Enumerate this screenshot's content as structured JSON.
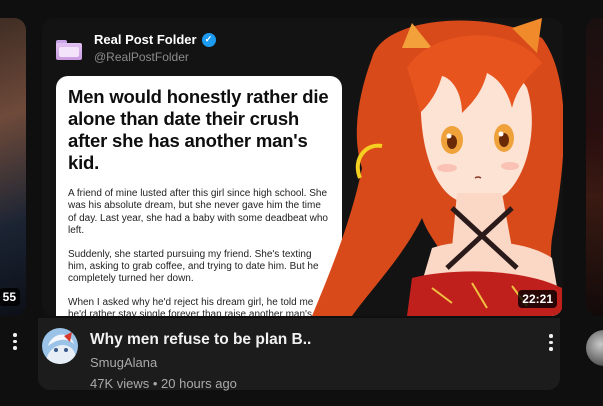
{
  "left_card": {
    "duration": "55"
  },
  "main_card": {
    "thumbnail": {
      "account_name": "Real Post Folder",
      "account_handle": "@RealPostFolder",
      "post_headline": "Men would honestly rather die alone than date their crush after she has another man's kid.",
      "post_paragraphs": [
        "A friend of mine lusted after this girl since high school. She was his absolute dream, but she never gave him the time of day. Last year, she had a baby with some deadbeat who left.",
        "Suddenly, she started pursuing my friend. She's texting him, asking to grab coffee, and trying to date him. But he completely turned her down.",
        "When I asked why he'd reject his dream girl, he told me he'd rather stay single forever than raise another man's kid after being her backup choice for a decade. H..."
      ],
      "duration": "22:21"
    },
    "title": "Why men refuse to be plan B..",
    "channel": "SmugAlana",
    "stats": "47K views • 20 hours ago"
  },
  "colors": {
    "background": "#0f0f0f",
    "card_hover": "#1c1c1c",
    "secondary_text": "#aaaaaa",
    "verified_blue": "#1d9bf0",
    "hair_orange": "#e8541e"
  }
}
